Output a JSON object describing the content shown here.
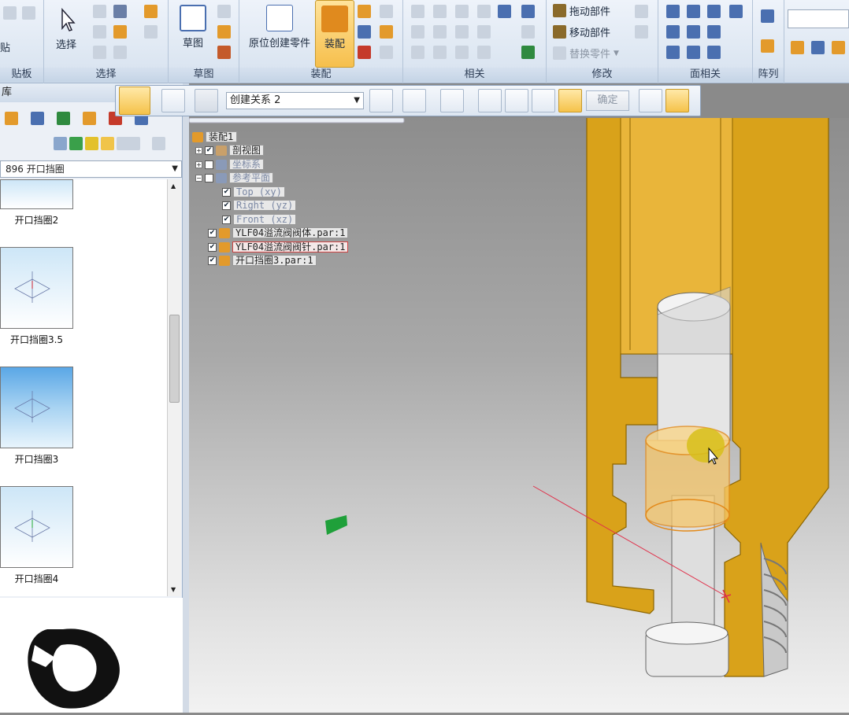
{
  "ribbon": {
    "groups": [
      {
        "label": "贴板",
        "buttons": [
          "贴"
        ]
      },
      {
        "label": "选择",
        "buttons": [
          "选择"
        ]
      },
      {
        "label": "草图",
        "buttons": [
          "草图"
        ]
      },
      {
        "label": "装配",
        "buttons": [
          "原位创建零件",
          "装配"
        ]
      },
      {
        "label": "相关",
        "buttons": []
      },
      {
        "label": "修改",
        "buttons": [
          "拖动部件",
          "移动部件",
          "替换零件"
        ]
      },
      {
        "label": "面相关",
        "buttons": []
      },
      {
        "label": "阵列",
        "buttons": []
      }
    ]
  },
  "command_bar": {
    "relation_select": "创建关系 2",
    "ok_label": "确定"
  },
  "library": {
    "header": "库",
    "path": "896  开口挡圈",
    "items": [
      "开口挡圈2",
      "开口挡圈3.5",
      "开口挡圈3",
      "开口挡圈4"
    ]
  },
  "tree": {
    "root": "装配1",
    "nodes": [
      {
        "label": "剖视图",
        "checked": true
      },
      {
        "label": "坐标系",
        "checked": false
      },
      {
        "label": "参考平面",
        "checked": false
      },
      {
        "label": "Top (xy)",
        "checked": true
      },
      {
        "label": "Right (yz)",
        "checked": true
      },
      {
        "label": "Front (xz)",
        "checked": true
      },
      {
        "label": "YLF04溢流阀阀体.par:1",
        "checked": true
      },
      {
        "label": "YLF04溢流阀阀针.par:1",
        "checked": true
      },
      {
        "label": "开口挡圈3.par:1",
        "checked": true
      }
    ]
  },
  "colors": {
    "accent": "#f5b63a",
    "part": "#d9a21a"
  }
}
